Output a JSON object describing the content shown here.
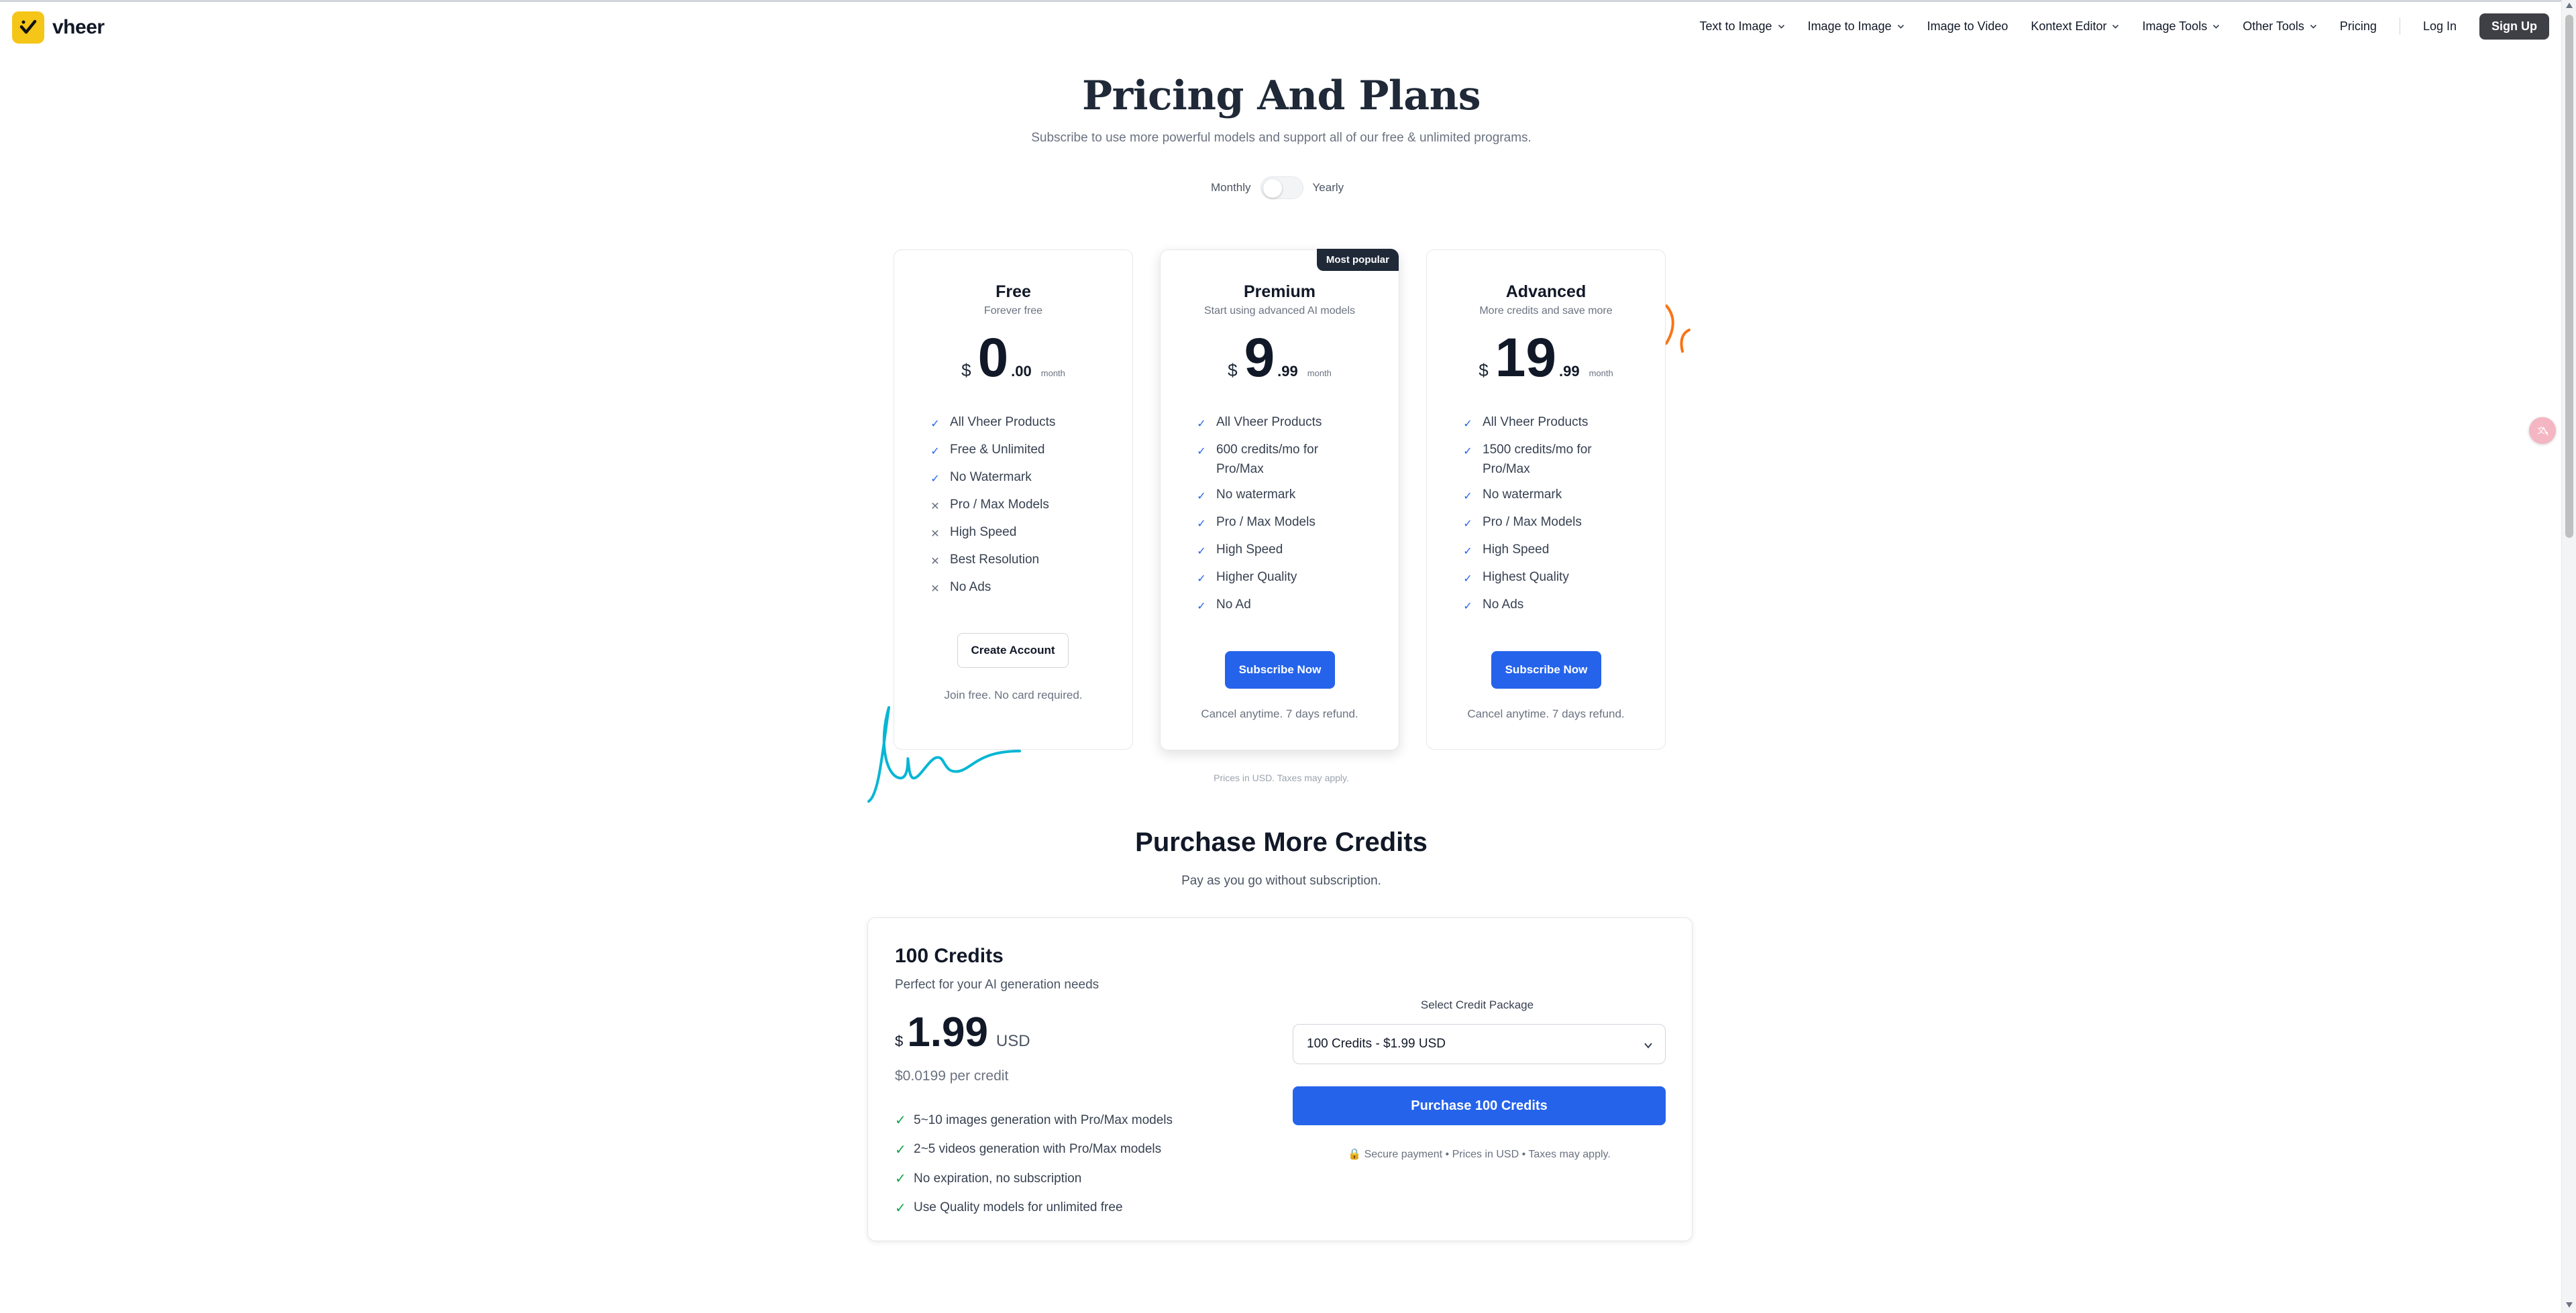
{
  "brand": {
    "name": "vheer",
    "color": "#f5c518"
  },
  "nav": {
    "items": [
      {
        "label": "Text to Image",
        "dropdown": true
      },
      {
        "label": "Image to Image",
        "dropdown": true
      },
      {
        "label": "Image to Video",
        "dropdown": false
      },
      {
        "label": "Kontext Editor",
        "dropdown": true
      },
      {
        "label": "Image Tools",
        "dropdown": true
      },
      {
        "label": "Other Tools",
        "dropdown": true
      },
      {
        "label": "Pricing",
        "dropdown": false
      }
    ],
    "login": "Log In",
    "signup": "Sign Up"
  },
  "hero": {
    "title": "Pricing And Plans",
    "subtitle": "Subscribe to use more powerful models and support all of our free & unlimited programs."
  },
  "billing": {
    "monthly": "Monthly",
    "yearly": "Yearly",
    "yearly_selected": false
  },
  "plans": [
    {
      "name": "Free",
      "desc": "Forever free",
      "currency": "$",
      "price_int": "0",
      "price_dec": ".00",
      "period": "month",
      "features": [
        {
          "text": "All Vheer Products",
          "included": true
        },
        {
          "text": "Free & Unlimited",
          "included": true
        },
        {
          "text": "No Watermark",
          "included": true
        },
        {
          "text": "Pro / Max Models",
          "included": false
        },
        {
          "text": "High Speed",
          "included": false
        },
        {
          "text": "Best Resolution",
          "included": false
        },
        {
          "text": "No Ads",
          "included": false
        }
      ],
      "cta": "Create Account",
      "note": "Join free. No card required."
    },
    {
      "name": "Premium",
      "desc": "Start using advanced AI models",
      "badge": "Most popular",
      "currency": "$",
      "price_int": "9",
      "price_dec": ".99",
      "period": "month",
      "features": [
        {
          "text": "All Vheer Products",
          "included": true
        },
        {
          "text": "600 credits/mo for Pro/Max",
          "included": true
        },
        {
          "text": "No watermark",
          "included": true
        },
        {
          "text": "Pro / Max Models",
          "included": true
        },
        {
          "text": "High Speed",
          "included": true
        },
        {
          "text": "Higher Quality",
          "included": true
        },
        {
          "text": "No Ad",
          "included": true
        }
      ],
      "cta": "Subscribe Now",
      "note": "Cancel anytime. 7 days refund."
    },
    {
      "name": "Advanced",
      "desc": "More credits and save more",
      "currency": "$",
      "price_int": "19",
      "price_dec": ".99",
      "period": "month",
      "features": [
        {
          "text": "All Vheer Products",
          "included": true
        },
        {
          "text": "1500 credits/mo for Pro/Max",
          "included": true
        },
        {
          "text": "No watermark",
          "included": true
        },
        {
          "text": "Pro / Max Models",
          "included": true
        },
        {
          "text": "High Speed",
          "included": true
        },
        {
          "text": "Highest Quality",
          "included": true
        },
        {
          "text": "No Ads",
          "included": true
        }
      ],
      "cta": "Subscribe Now",
      "note": "Cancel anytime. 7 days refund."
    }
  ],
  "prices_note": "Prices in USD. Taxes may apply.",
  "credits": {
    "title": "Purchase More Credits",
    "subtitle": "Pay as you go without subscription.",
    "package": {
      "name": "100 Credits",
      "desc": "Perfect for your AI generation needs",
      "currency": "$",
      "amount": "1.99",
      "unit": "USD",
      "per_credit": "$0.0199 per credit",
      "features": [
        "5~10 images generation with Pro/Max models",
        "2~5 videos generation with Pro/Max models",
        "No expiration, no subscription",
        "Use Quality models for unlimited free"
      ]
    },
    "select_label": "Select Credit Package",
    "select_value": "100 Credits - $1.99 USD",
    "purchase_label": "Purchase 100 Credits",
    "secure_note": "🔒 Secure payment • Prices in USD • Taxes may apply."
  },
  "colors": {
    "accent": "#2563eb",
    "check": "#16a34a",
    "badge_bg": "#1f2937",
    "signup_bg": "#3f3f46"
  }
}
